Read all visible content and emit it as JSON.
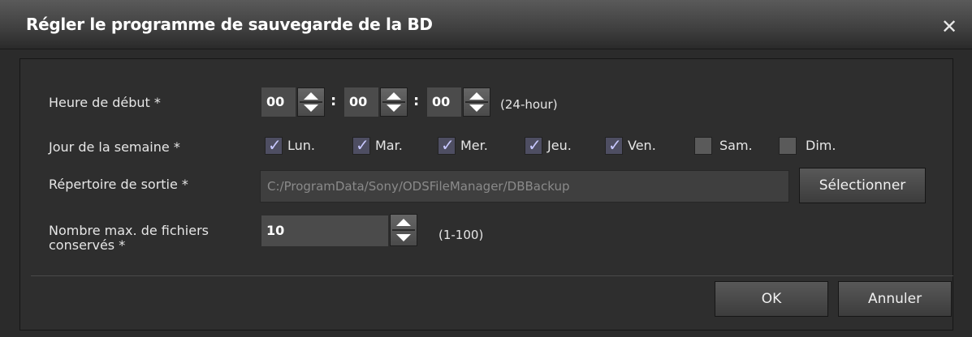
{
  "dialog": {
    "title": "Régler le programme de sauvegarde de la BD",
    "close_glyph": "✕"
  },
  "start_time": {
    "label": "Heure de début *",
    "hour": "00",
    "minute": "00",
    "second": "00",
    "separator": ":",
    "format_hint": "(24-hour)"
  },
  "weekdays": {
    "label": "Jour de la semaine *",
    "days": [
      {
        "label": "Lun.",
        "checked": true
      },
      {
        "label": "Mar.",
        "checked": true
      },
      {
        "label": "Mer.",
        "checked": true
      },
      {
        "label": "Jeu.",
        "checked": true
      },
      {
        "label": "Ven.",
        "checked": true
      },
      {
        "label": "Sam.",
        "checked": false
      },
      {
        "label": "Dim.",
        "checked": false
      }
    ]
  },
  "output_dir": {
    "label": "Répertoire de sortie *",
    "value": "C:/ProgramData/Sony/ODSFileManager/DBBackup",
    "select_label": "Sélectionner"
  },
  "max_files": {
    "label_line1": "Nombre max. de fichiers",
    "label_line2": "conservés *",
    "value": "10",
    "range_hint": "(1-100)"
  },
  "footer": {
    "ok_label": "OK",
    "cancel_label": "Annuler"
  },
  "icons": {
    "check": "✓"
  }
}
